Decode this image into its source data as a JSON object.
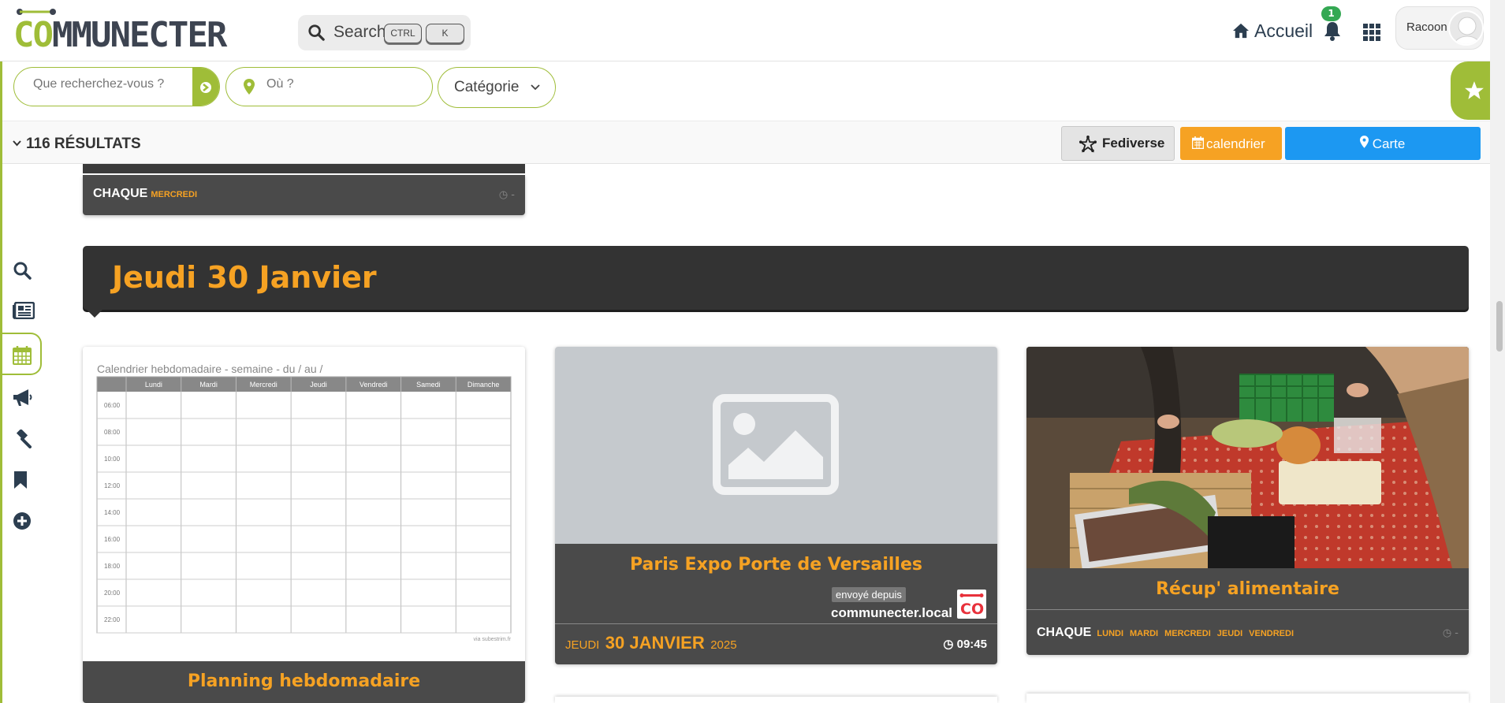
{
  "header": {
    "logo_text_co": "CO",
    "logo_text_rest": "MMUNECTER",
    "search_label": "Search",
    "kbd_ctrl": "CTRL",
    "kbd_k": "K",
    "home_label": "Accueil",
    "notification_count": "1",
    "user_name": "Racoon"
  },
  "filters": {
    "what_placeholder": "Que recherchez-vous ?",
    "where_placeholder": "Où ?",
    "category_label": "Catégorie"
  },
  "results": {
    "count_label": "116 RÉSULTATS",
    "fediverse_label": "Fediverse",
    "calendar_label": "calendrier",
    "map_label": "Carte"
  },
  "sidebar": {
    "items": [
      "search-icon",
      "newspaper-icon",
      "calendar-icon",
      "bullhorn-icon",
      "gavel-icon",
      "bookmark-icon",
      "plus-circle-icon"
    ],
    "active": "calendar-icon"
  },
  "previous_card": {
    "recurrence_label": "CHAQUE",
    "days": [
      "MERCREDI"
    ]
  },
  "day_header": "Jeudi 30 Janvier",
  "cards": [
    {
      "image_caption": "Calendrier hebdomadaire - semaine      - du     /     au     /",
      "schedule_days": [
        "Lundi",
        "Mardi",
        "Mercredi",
        "Jeudi",
        "Vendredi",
        "Samedi",
        "Dimanche"
      ],
      "schedule_hours": [
        "06:00",
        "08:00",
        "10:00",
        "12:00",
        "14:00",
        "16:00",
        "18:00",
        "20:00",
        "22:00"
      ],
      "image_footer": "via subestrim.fr",
      "title": "Planning hebdomadaire"
    },
    {
      "title": "Paris Expo Porte de Versailles",
      "sent_from_label": "envoyé depuis",
      "source": "communecter.local",
      "date_dow": "JEUDI",
      "date_day_month": "30 JANVIER",
      "date_year": "2025",
      "time": "09:45"
    },
    {
      "title": "Récup' alimentaire",
      "recurrence_label": "CHAQUE",
      "days": [
        "LUNDI",
        "MARDI",
        "MERCREDI",
        "JEUDI",
        "VENDREDI"
      ]
    }
  ],
  "colors": {
    "brand_green": "#9fbd38",
    "accent_orange": "#f6a223",
    "map_blue": "#1c98f2",
    "dark_card": "#4a4a4a"
  }
}
